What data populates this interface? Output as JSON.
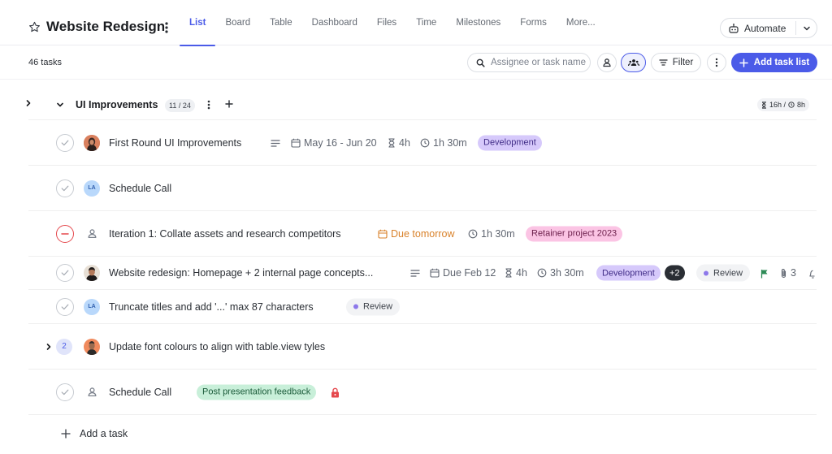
{
  "header": {
    "title": "Website Redesign",
    "tabs": [
      {
        "label": "List",
        "active": true
      },
      {
        "label": "Board",
        "active": false
      },
      {
        "label": "Table",
        "active": false
      },
      {
        "label": "Dashboard",
        "active": false
      },
      {
        "label": "Files",
        "active": false
      },
      {
        "label": "Time",
        "active": false
      },
      {
        "label": "Milestones",
        "active": false
      },
      {
        "label": "Forms",
        "active": false
      },
      {
        "label": "More...",
        "active": false
      }
    ],
    "automate_label": "Automate"
  },
  "toolbar": {
    "task_count": "46 tasks",
    "search_placeholder": "Assignee or task name",
    "filter_label": "Filter",
    "add_list_label": "Add task list"
  },
  "group": {
    "name": "UI Improvements",
    "count": "11 / 24",
    "estimate": "16h / ",
    "estimate_logged": "8h"
  },
  "tasks": [
    {
      "title": "First Round UI Improvements",
      "dates": "May 16 - Jun 20",
      "estimate": "4h",
      "time": "1h 30m",
      "tag": "Development"
    },
    {
      "title": "Schedule Call",
      "avatar": "LA"
    },
    {
      "title": "Iteration 1: Collate assets and research competitors",
      "due": "Due tomorrow",
      "time": "1h 30m",
      "tag": "Retainer project 2023"
    },
    {
      "title": "Website redesign: Homepage + 2 internal page concepts...",
      "dates": "Due Feb 12",
      "estimate": "4h",
      "time": "3h 30m",
      "tag": "Development",
      "more_tags": "+2",
      "status": "Review",
      "attachments": "3"
    },
    {
      "title": "Truncate titles and add '...' max 87 characters",
      "avatar": "LA",
      "status": "Review"
    },
    {
      "title": "Update font colours to align with table.view tyles",
      "subtasks": "2"
    },
    {
      "title": "Schedule Call",
      "tag": "Post presentation feedback"
    }
  ],
  "add_task_label": "Add a task",
  "colors": {
    "accent": "#4b5be8",
    "development": "#d6c9fb",
    "retainer": "#fbc4e4",
    "feedback": "#c8efd9"
  }
}
